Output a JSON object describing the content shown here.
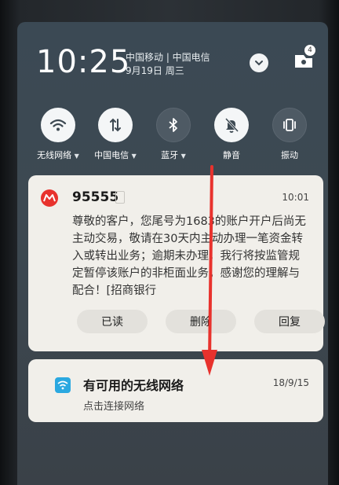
{
  "status": {
    "time": "10:25",
    "carriers": "中国移动 | 中国电信",
    "date": "9月19日 周三",
    "notification_badge": "4"
  },
  "toggles": [
    {
      "label": "无线网络",
      "caret": "▼",
      "icon": "wifi-icon",
      "state": "on"
    },
    {
      "label": "中国电信",
      "caret": "▼",
      "icon": "data-arrows-icon",
      "state": "on"
    },
    {
      "label": "蓝牙",
      "caret": "▼",
      "icon": "bluetooth-icon",
      "state": "off"
    },
    {
      "label": "静音",
      "caret": "",
      "icon": "bell-muted-icon",
      "state": "on"
    },
    {
      "label": "振动",
      "caret": "",
      "icon": "vibrate-icon",
      "state": "off"
    }
  ],
  "notifications": [
    {
      "sender": "95555",
      "time": "10:01",
      "body": "尊敬的客户，您尾号为1683的账户开户后尚无主动交易，敬请在30天内主动办理一笔资金转入或转出业务；逾期未办理，我行将按监管规定暂停该账户的非柜面业务。感谢您的理解与配合！[招商银行",
      "actions": [
        "已读",
        "删除",
        "回复"
      ],
      "icon": "bank-logo-icon"
    },
    {
      "title": "有可用的无线网络",
      "time": "18/9/15",
      "body": "点击连接网络",
      "icon": "wifi-app-icon"
    }
  ],
  "colors": {
    "accent_red": "#e8322d",
    "wifi_blue": "#2aa8e0",
    "card_bg": "#f1efea"
  }
}
